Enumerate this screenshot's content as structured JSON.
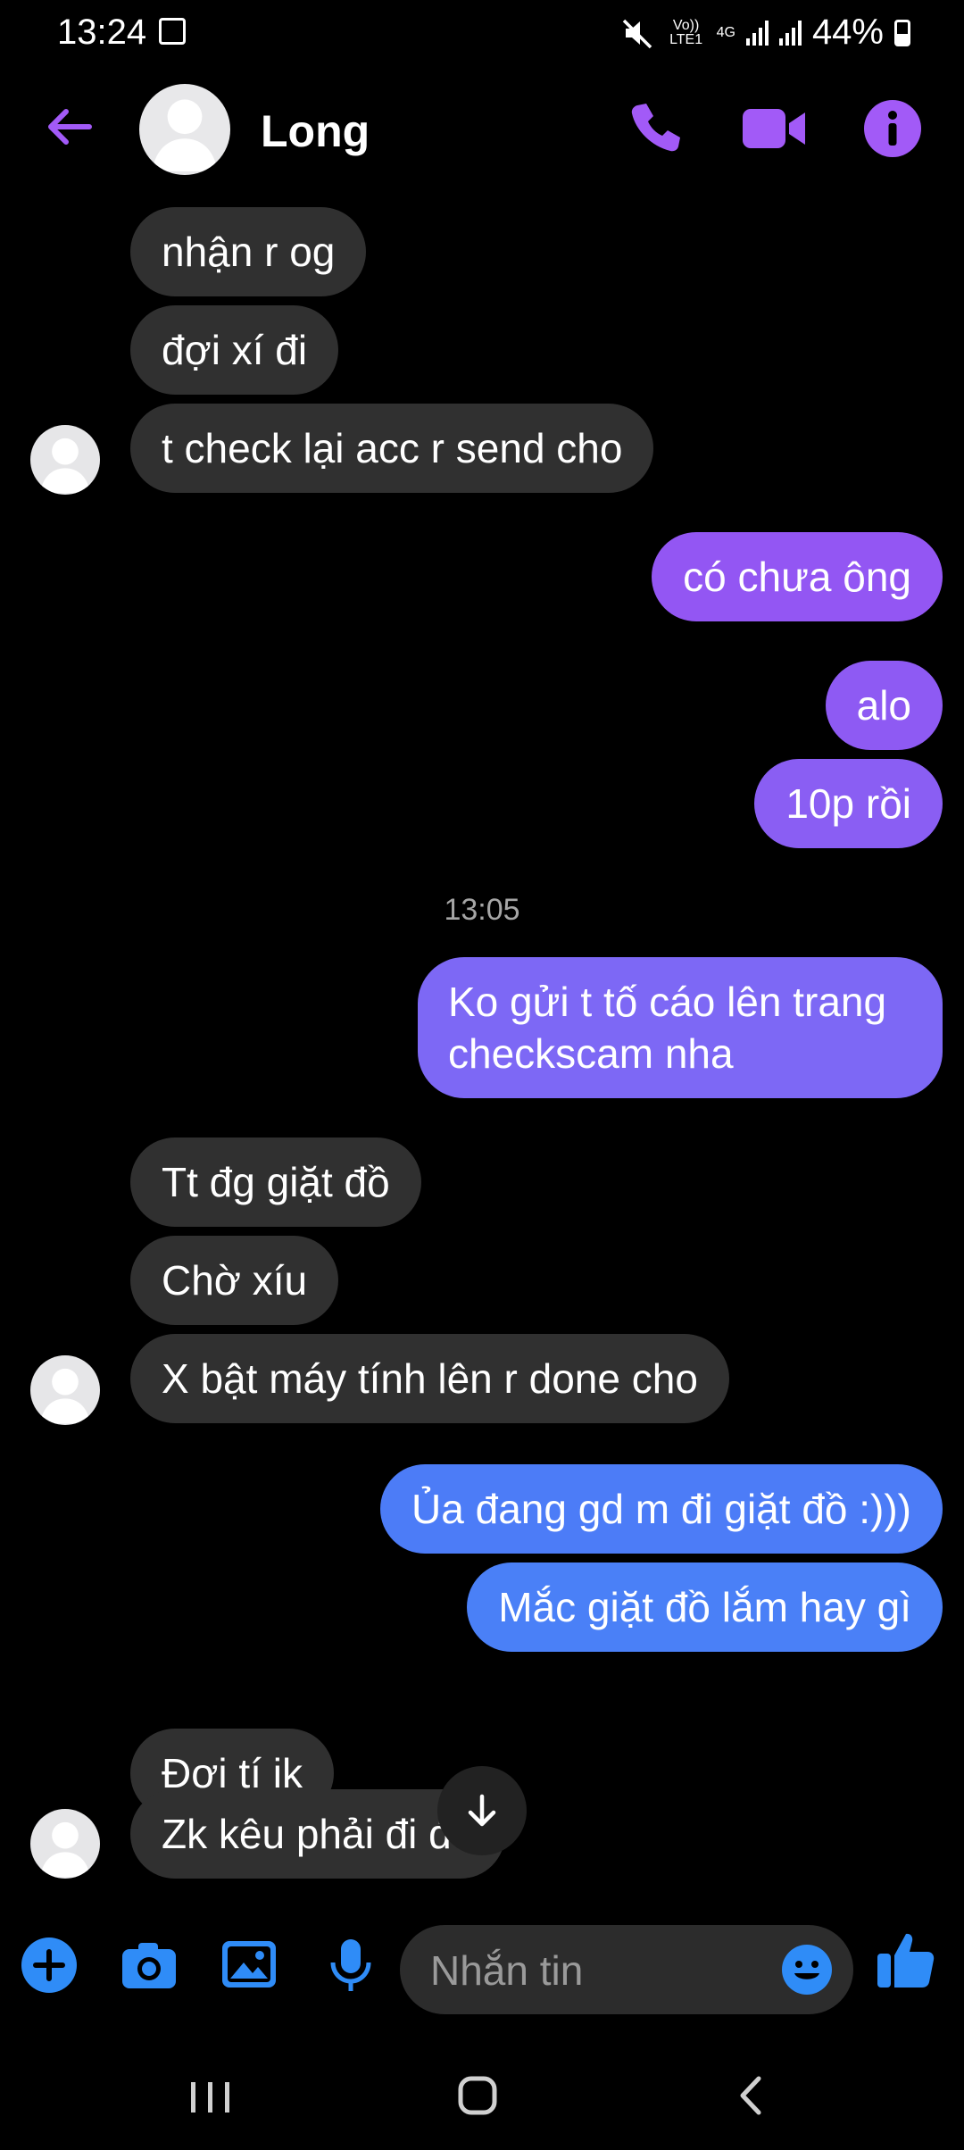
{
  "status_bar": {
    "time": "13:24",
    "network_top": "Vo)) LTE1",
    "network_mid": "4G",
    "battery": "44%"
  },
  "header": {
    "contact_name": "Long"
  },
  "timestamp": "13:05",
  "messages": [
    {
      "side": "in",
      "text": "nhận r og"
    },
    {
      "side": "in",
      "text": "đợi xí đi"
    },
    {
      "side": "in",
      "text": "t check lại acc r send cho"
    },
    {
      "side": "out",
      "text": "có chưa ông"
    },
    {
      "side": "out",
      "text": "alo"
    },
    {
      "side": "out",
      "text": "10p rồi"
    },
    {
      "side": "out",
      "text": "Ko gửi t tố cáo lên trang checkscam nha"
    },
    {
      "side": "in",
      "text": "Tt đg giặt đồ"
    },
    {
      "side": "in",
      "text": "Chờ xíu"
    },
    {
      "side": "in",
      "text": "X bật máy tính lên r done cho"
    },
    {
      "side": "out",
      "text": "Ủa đang gd m đi giặt đồ :)))"
    },
    {
      "side": "out",
      "text": "Mắc giặt đồ lắm hay gì"
    },
    {
      "side": "in",
      "text": "Đợi tí ik"
    },
    {
      "side": "in",
      "text": "Zk kêu phải đi đó"
    }
  ],
  "composer": {
    "placeholder": "Nhắn tin"
  },
  "colors": {
    "accent_purple": "#a25af7",
    "accent_blue": "#2f8cf7",
    "incoming_bubble": "#303030"
  }
}
